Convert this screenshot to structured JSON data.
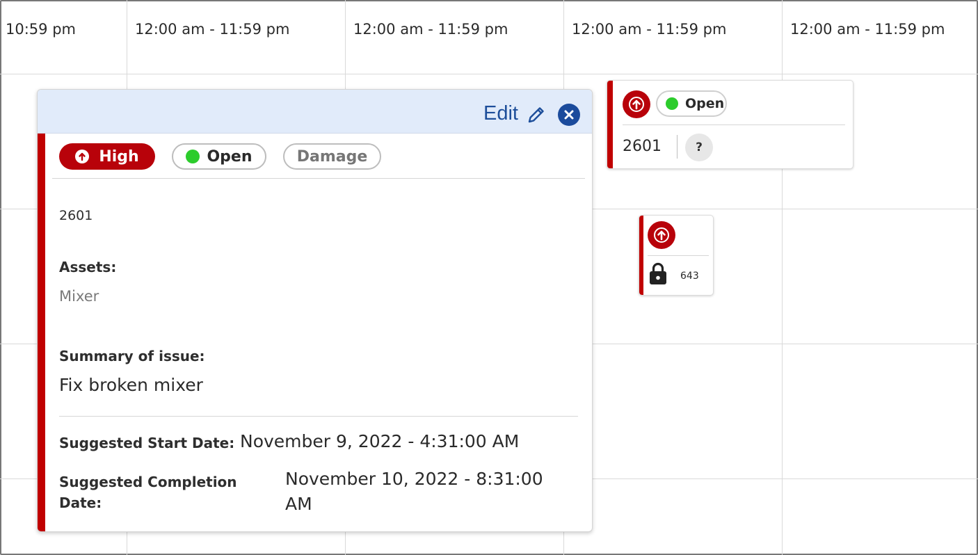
{
  "columns": [
    {
      "time_range": "10:59 pm"
    },
    {
      "time_range": "12:00 am - 11:59 pm"
    },
    {
      "time_range": "12:00 am - 11:59 pm"
    },
    {
      "time_range": "12:00 am - 11:59 pm"
    },
    {
      "time_range": "12:00 am - 11:59 pm"
    }
  ],
  "event_card_1": {
    "priority_icon": "arrow-up-circle-icon",
    "status": "Open",
    "id": "2601",
    "unknown_badge": "?"
  },
  "event_card_2": {
    "priority_icon": "arrow-up-circle-icon",
    "lock_icon": "lock-icon",
    "id": "643"
  },
  "popup": {
    "edit_label": "Edit",
    "priority": "High",
    "status": "Open",
    "category": "Damage",
    "id": "2601",
    "assets_label": "Assets:",
    "assets_value": "Mixer",
    "summary_label": "Summary of issue:",
    "summary_value": "Fix broken mixer",
    "start_label": "Suggested Start Date:",
    "start_value": "November 9, 2022 - 4:31:00 AM",
    "completion_label_line1": "Suggested Completion",
    "completion_label_line2": "Date:",
    "completion_value_line1": "November 10, 2022 - 8:31:00",
    "completion_value_line2": "AM"
  },
  "colors": {
    "priority_high": "#b8020a",
    "status_open": "#2ccc2c",
    "accent_blue": "#1d4e9a",
    "popup_header": "#e1ebfa"
  }
}
